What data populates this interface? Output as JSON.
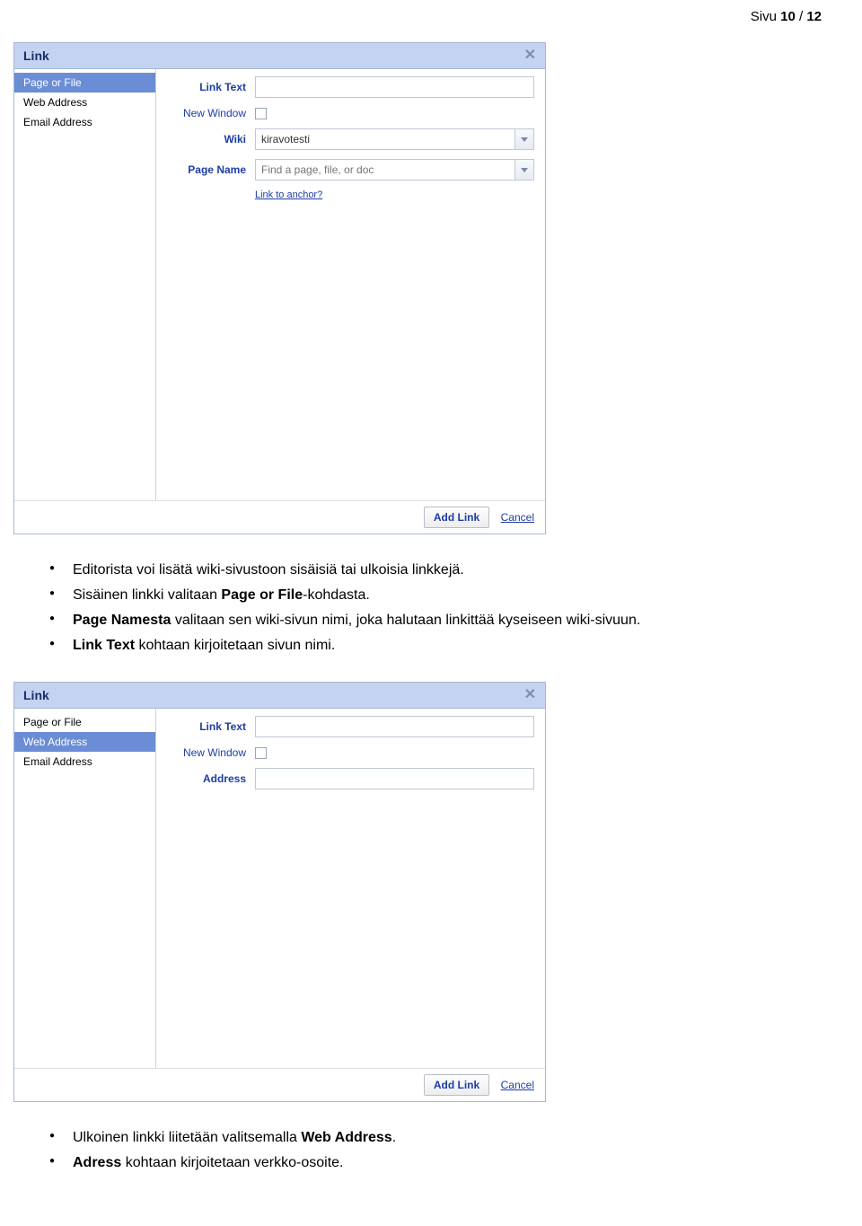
{
  "pageNumber": {
    "prefix": "Sivu ",
    "current": "10",
    "sep": " / ",
    "total": "12"
  },
  "dialog1": {
    "title": "Link",
    "sidebar": [
      {
        "label": "Page or File",
        "active": true
      },
      {
        "label": "Web Address",
        "active": false
      },
      {
        "label": "Email Address",
        "active": false
      }
    ],
    "fields": {
      "linkText": {
        "label": "Link Text",
        "value": ""
      },
      "newWindow": {
        "label": "New Window"
      },
      "wiki": {
        "label": "Wiki",
        "value": "kiravotesti"
      },
      "pageName": {
        "label": "Page Name",
        "placeholder": "Find a page, file, or doc"
      },
      "anchor": "Link to anchor?"
    },
    "footer": {
      "addLink": "Add Link",
      "cancel": "Cancel"
    }
  },
  "bullets1": {
    "items": [
      {
        "parts": [
          {
            "t": "Editorista voi lisätä wiki-sivustoon sisäisiä tai ulkoisia linkkejä."
          }
        ]
      },
      {
        "parts": [
          {
            "t": "Sisäinen linkki valitaan "
          },
          {
            "t": "Page or File",
            "b": true
          },
          {
            "t": "-kohdasta."
          }
        ]
      },
      {
        "parts": [
          {
            "t": "Page Namesta",
            "b": true
          },
          {
            "t": " valitaan sen wiki-sivun nimi, joka halutaan linkittää kyseiseen wiki-sivuun."
          }
        ]
      },
      {
        "parts": [
          {
            "t": "Link Text",
            "b": true
          },
          {
            "t": " kohtaan kirjoitetaan sivun nimi."
          }
        ]
      }
    ]
  },
  "dialog2": {
    "title": "Link",
    "sidebar": [
      {
        "label": "Page or File",
        "active": false
      },
      {
        "label": "Web Address",
        "active": true
      },
      {
        "label": "Email Address",
        "active": false
      }
    ],
    "fields": {
      "linkText": {
        "label": "Link Text",
        "value": ""
      },
      "newWindow": {
        "label": "New Window"
      },
      "address": {
        "label": "Address",
        "value": ""
      }
    },
    "footer": {
      "addLink": "Add Link",
      "cancel": "Cancel"
    }
  },
  "bullets2": {
    "items": [
      {
        "parts": [
          {
            "t": "Ulkoinen linkki liitetään valitsemalla "
          },
          {
            "t": "Web Address",
            "b": true
          },
          {
            "t": "."
          }
        ]
      },
      {
        "parts": [
          {
            "t": "Adress",
            "b": true
          },
          {
            "t": " kohtaan kirjoitetaan verkko-osoite."
          }
        ]
      }
    ]
  }
}
